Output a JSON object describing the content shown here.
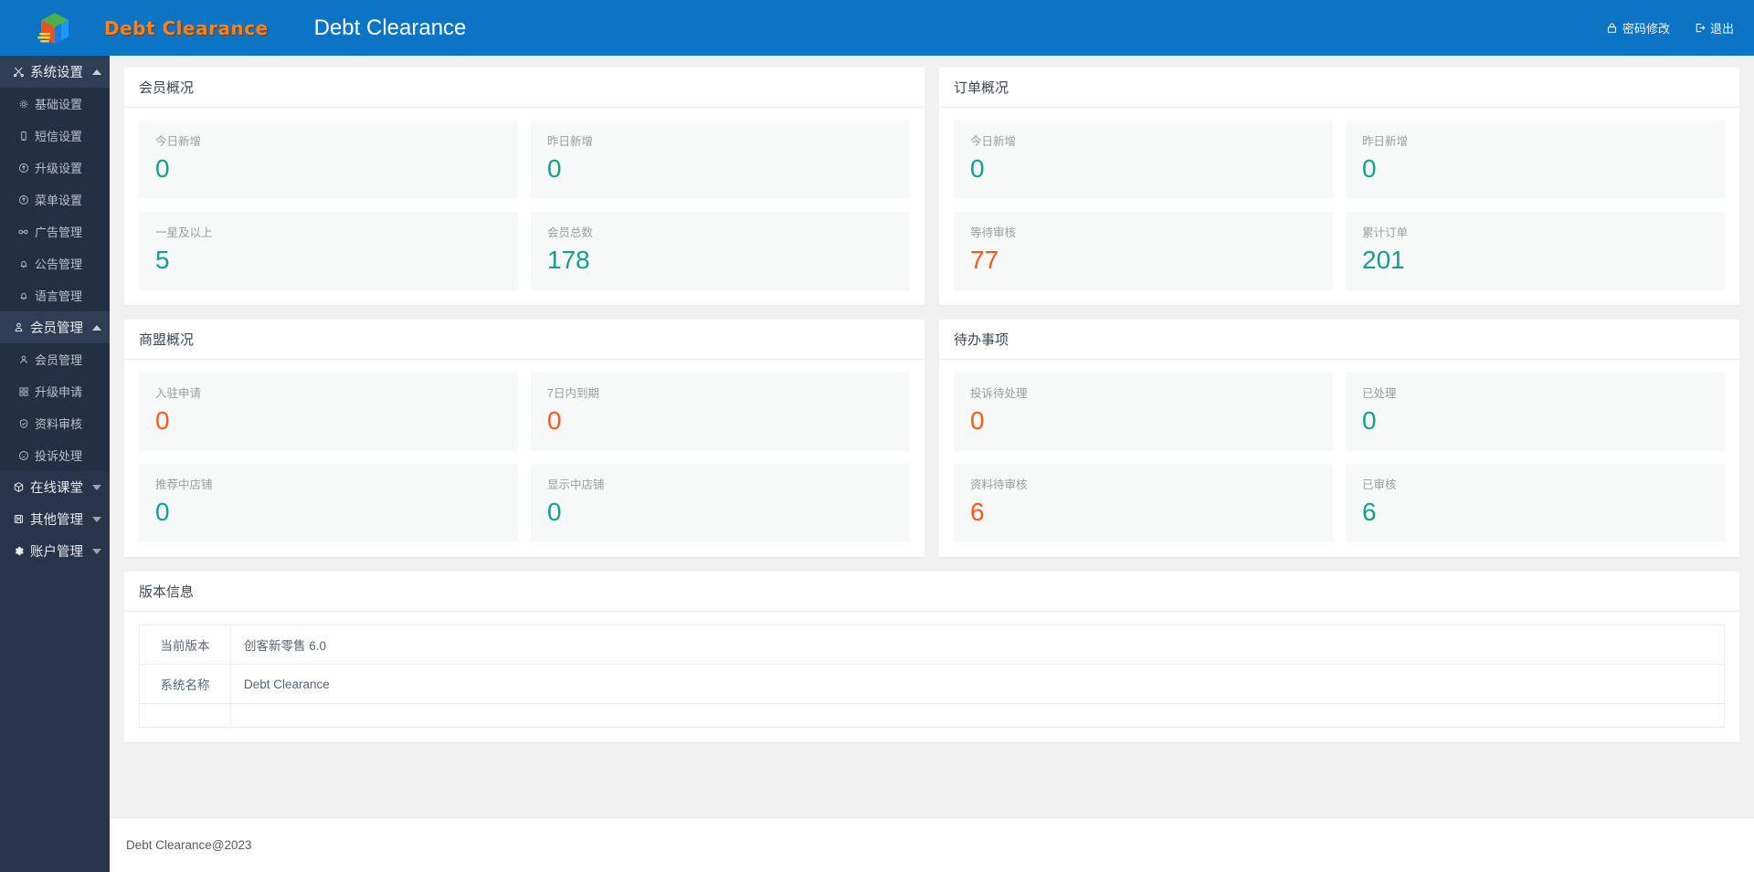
{
  "topbar": {
    "brand_text": "Debt Clearance",
    "app_title": "Debt Clearance",
    "actions": [
      {
        "label": "密码修改",
        "icon": "lock-icon"
      },
      {
        "label": "退出",
        "icon": "logout-icon"
      }
    ]
  },
  "sidebar": {
    "groups": [
      {
        "label": "系统设置",
        "icon": "scissors-icon",
        "open": true,
        "items": [
          {
            "label": "基础设置",
            "icon": "gear-icon"
          },
          {
            "label": "短信设置",
            "icon": "mobile-icon"
          },
          {
            "label": "升级设置",
            "icon": "up-circle-icon"
          },
          {
            "label": "菜单设置",
            "icon": "up-circle-icon"
          },
          {
            "label": "广告管理",
            "icon": "glasses-icon"
          },
          {
            "label": "公告管理",
            "icon": "bell-icon"
          },
          {
            "label": "语言管理",
            "icon": "bell-icon"
          }
        ]
      },
      {
        "label": "会员管理",
        "icon": "user-badge-icon",
        "open": true,
        "items": [
          {
            "label": "会员管理",
            "icon": "user-icon"
          },
          {
            "label": "升级申请",
            "icon": "grid-icon"
          },
          {
            "label": "资料审核",
            "icon": "shield-check-icon"
          },
          {
            "label": "投诉处理",
            "icon": "sad-face-icon"
          }
        ]
      },
      {
        "label": "在线课堂",
        "icon": "cube-icon",
        "open": false,
        "items": []
      },
      {
        "label": "其他管理",
        "icon": "save-icon",
        "open": false,
        "items": []
      },
      {
        "label": "账户管理",
        "icon": "gear-icon",
        "open": false,
        "items": []
      }
    ]
  },
  "panels": {
    "member_overview": {
      "title": "会员概况",
      "cards": [
        {
          "label": "今日新增",
          "value": "0",
          "color": "teal"
        },
        {
          "label": "昨日新增",
          "value": "0",
          "color": "teal"
        },
        {
          "label": "一星及以上",
          "value": "5",
          "color": "teal"
        },
        {
          "label": "会员总数",
          "value": "178",
          "color": "teal"
        }
      ]
    },
    "order_overview": {
      "title": "订单概况",
      "cards": [
        {
          "label": "今日新增",
          "value": "0",
          "color": "teal"
        },
        {
          "label": "昨日新增",
          "value": "0",
          "color": "teal"
        },
        {
          "label": "等待审核",
          "value": "77",
          "color": "orange"
        },
        {
          "label": "累计订单",
          "value": "201",
          "color": "teal"
        }
      ]
    },
    "alliance_overview": {
      "title": "商盟概况",
      "cards": [
        {
          "label": "入驻申请",
          "value": "0",
          "color": "orange"
        },
        {
          "label": "7日内到期",
          "value": "0",
          "color": "orange"
        },
        {
          "label": "推荐中店铺",
          "value": "0",
          "color": "teal"
        },
        {
          "label": "显示中店铺",
          "value": "0",
          "color": "teal"
        }
      ]
    },
    "todo": {
      "title": "待办事项",
      "cards": [
        {
          "label": "投诉待处理",
          "value": "0",
          "color": "orange"
        },
        {
          "label": "已处理",
          "value": "0",
          "color": "teal"
        },
        {
          "label": "资料待审核",
          "value": "6",
          "color": "orange"
        },
        {
          "label": "已审核",
          "value": "6",
          "color": "teal"
        }
      ]
    },
    "version_info": {
      "title": "版本信息",
      "rows": [
        {
          "key": "当前版本",
          "value": "创客新零售 6.0"
        },
        {
          "key": "系统名称",
          "value": "Debt Clearance"
        },
        {
          "key": "",
          "value": ""
        }
      ]
    }
  },
  "footer": {
    "text": "Debt Clearance@2023"
  },
  "colors": {
    "topbar": "#0b74c4",
    "sidebar": "#273449",
    "teal": "#13a08a",
    "orange": "#ff5722",
    "brand_orange": "#f5821f"
  }
}
